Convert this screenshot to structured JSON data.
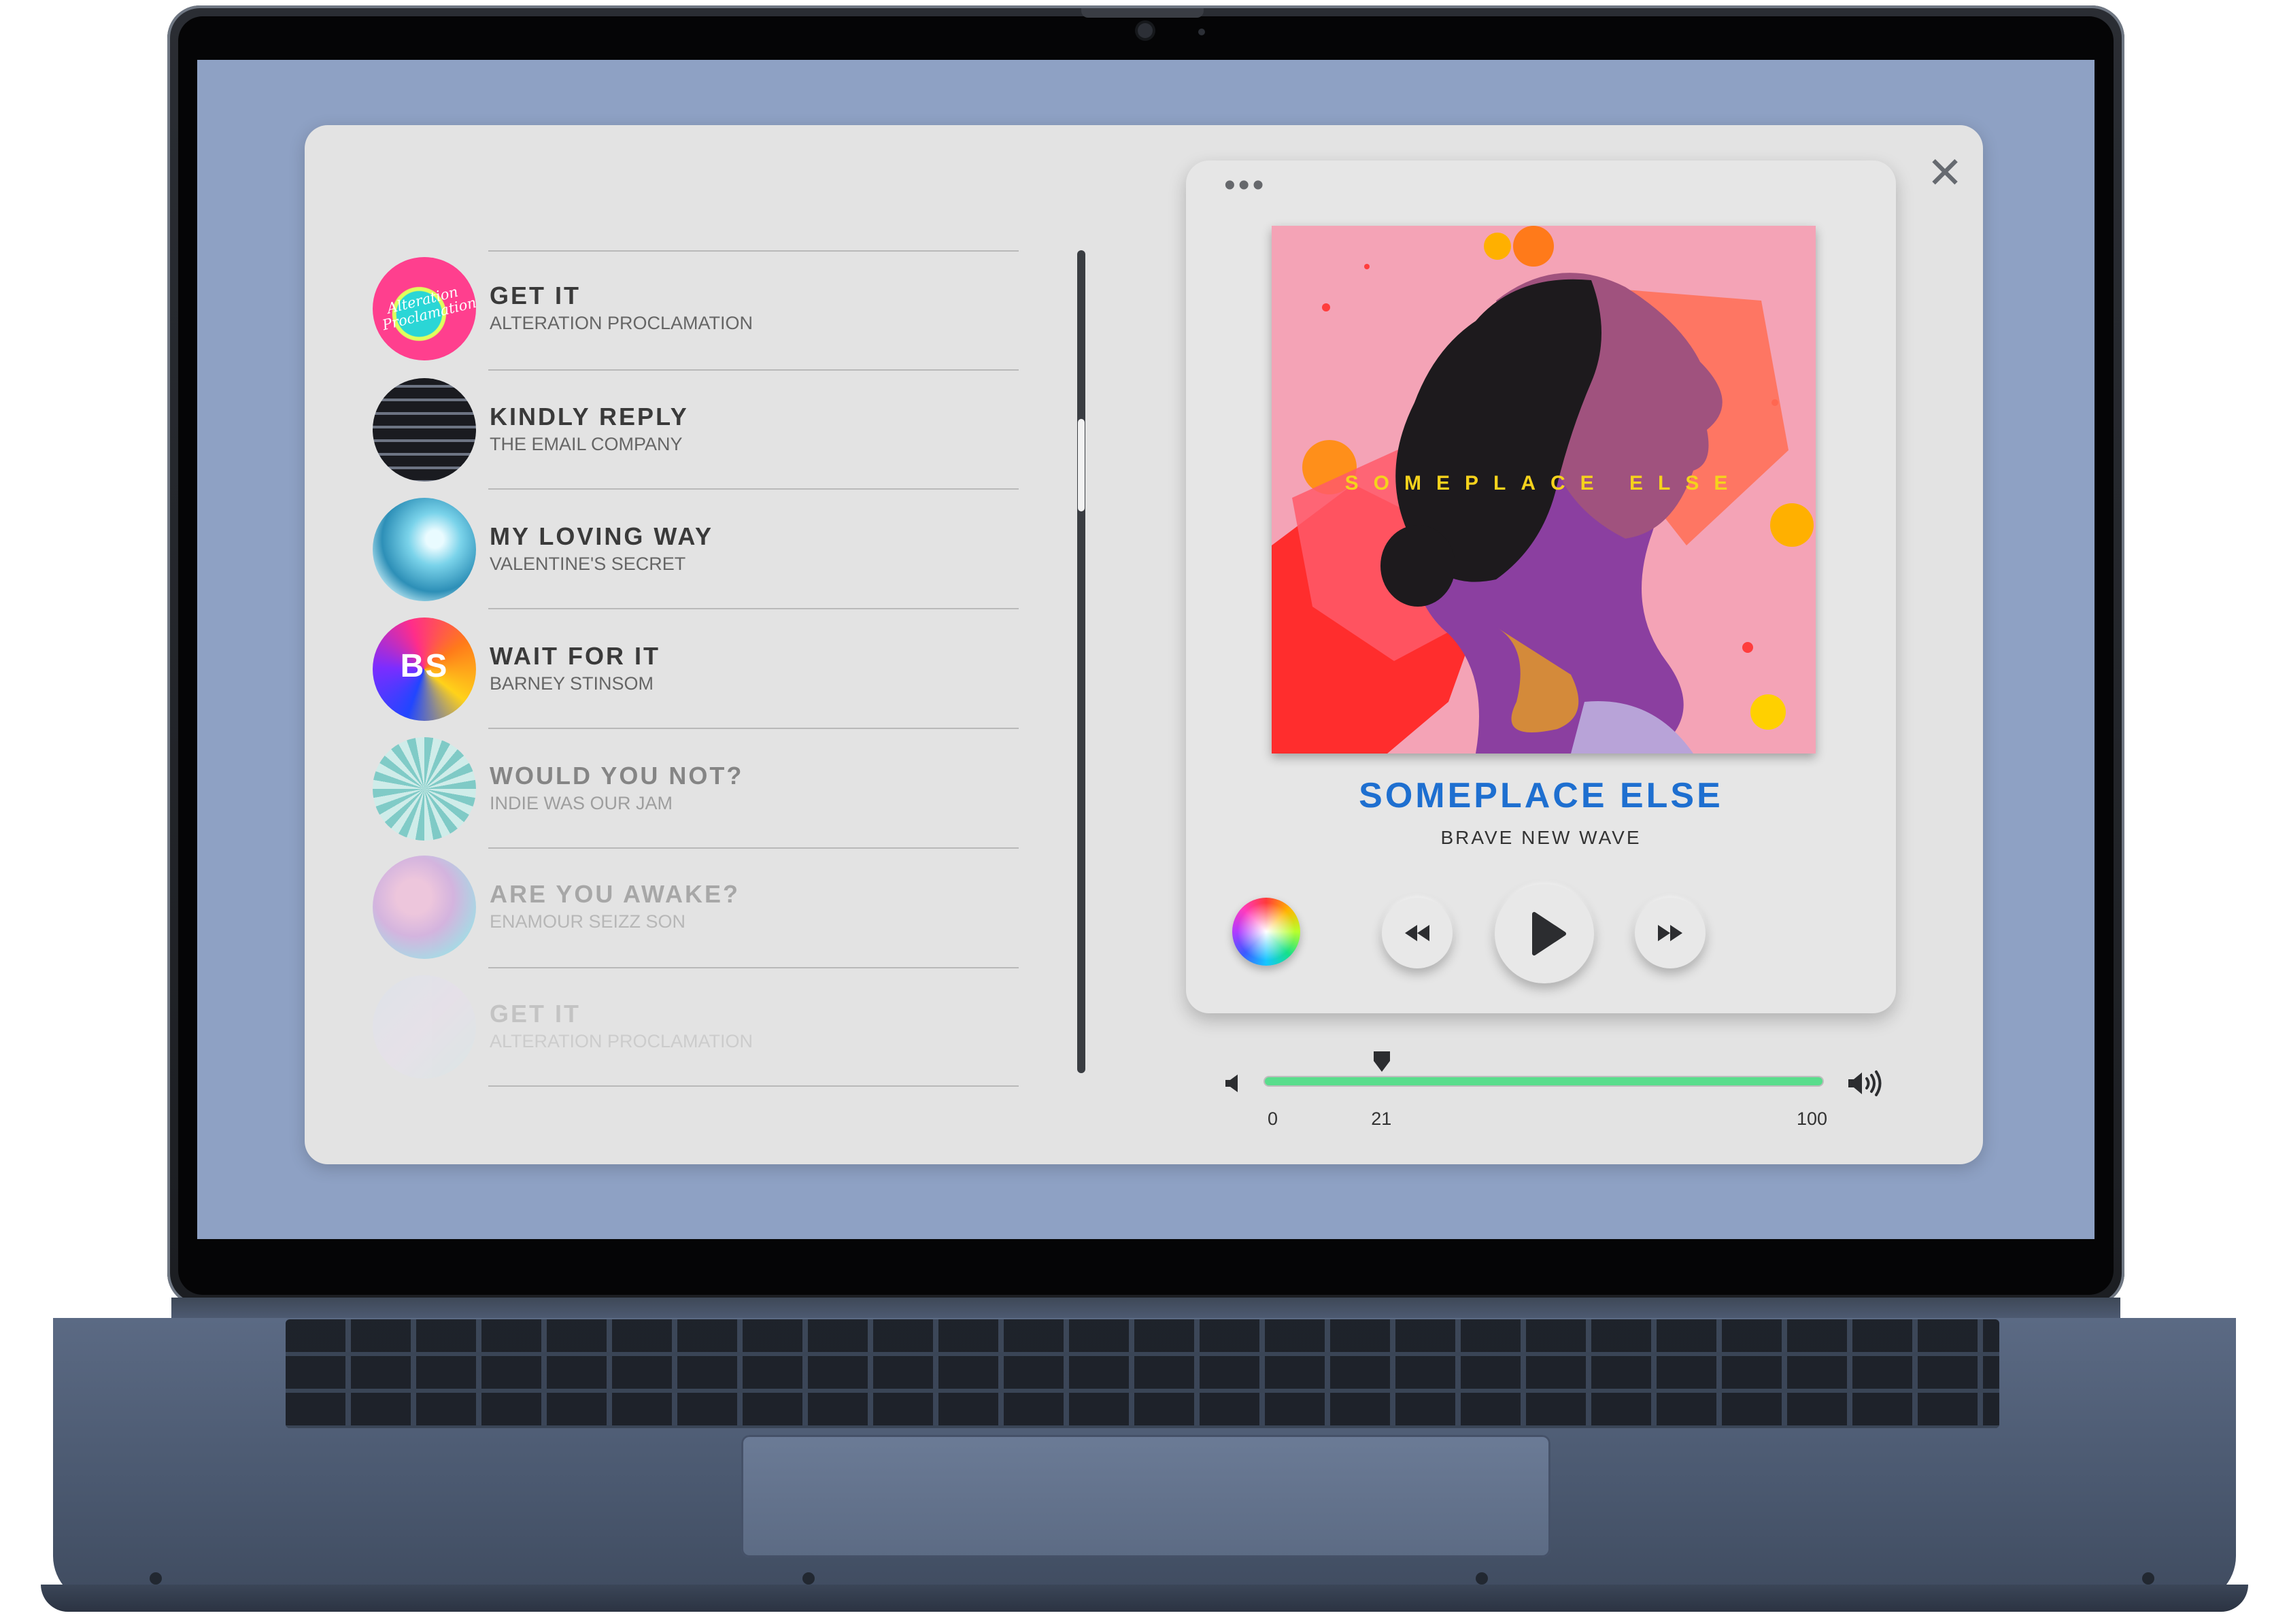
{
  "window": {
    "close_icon": "close-icon",
    "menu_icon": "more-dots-icon"
  },
  "tracks": [
    {
      "title": "GET IT",
      "artist": "ALTERATION PROCLAMATION",
      "art": "Alteration Proclamation",
      "opacity": 1.0
    },
    {
      "title": "KINDLY REPLY",
      "artist": "THE EMAIL COMPANY",
      "opacity": 1.0
    },
    {
      "title": "MY LOVING WAY",
      "artist": "VALENTINE'S SECRET",
      "opacity": 1.0
    },
    {
      "title": "WAIT FOR IT",
      "artist": "BARNEY STINSOM",
      "art": "BS",
      "opacity": 1.0
    },
    {
      "title": "WOULD YOU NOT?",
      "artist": "INDIE WAS OUR JAM",
      "opacity": 0.55
    },
    {
      "title": "ARE YOU AWAKE?",
      "artist": "ENAMOUR SEIZZ SON",
      "opacity": 0.35
    },
    {
      "title": "GET IT",
      "artist": "ALTERATION PROCLAMATION",
      "opacity": 0.18
    }
  ],
  "now_playing": {
    "cover_text": "SOMEPLACE ELSE",
    "title": "SOMEPLACE ELSE",
    "artist": "BRAVE NEW WAVE",
    "title_color": "#1e6fd0"
  },
  "controls": {
    "color_picker_icon": "color-wheel-icon",
    "prev_icon": "rewind-icon",
    "play_icon": "play-icon",
    "next_icon": "fast-forward-icon"
  },
  "volume": {
    "min_label": "0",
    "value_label": "21",
    "max_label": "100",
    "min": 0,
    "value": 21,
    "max": 100,
    "rail_color": "#59dd8c",
    "low_icon": "volume-low-icon",
    "high_icon": "volume-high-icon"
  }
}
